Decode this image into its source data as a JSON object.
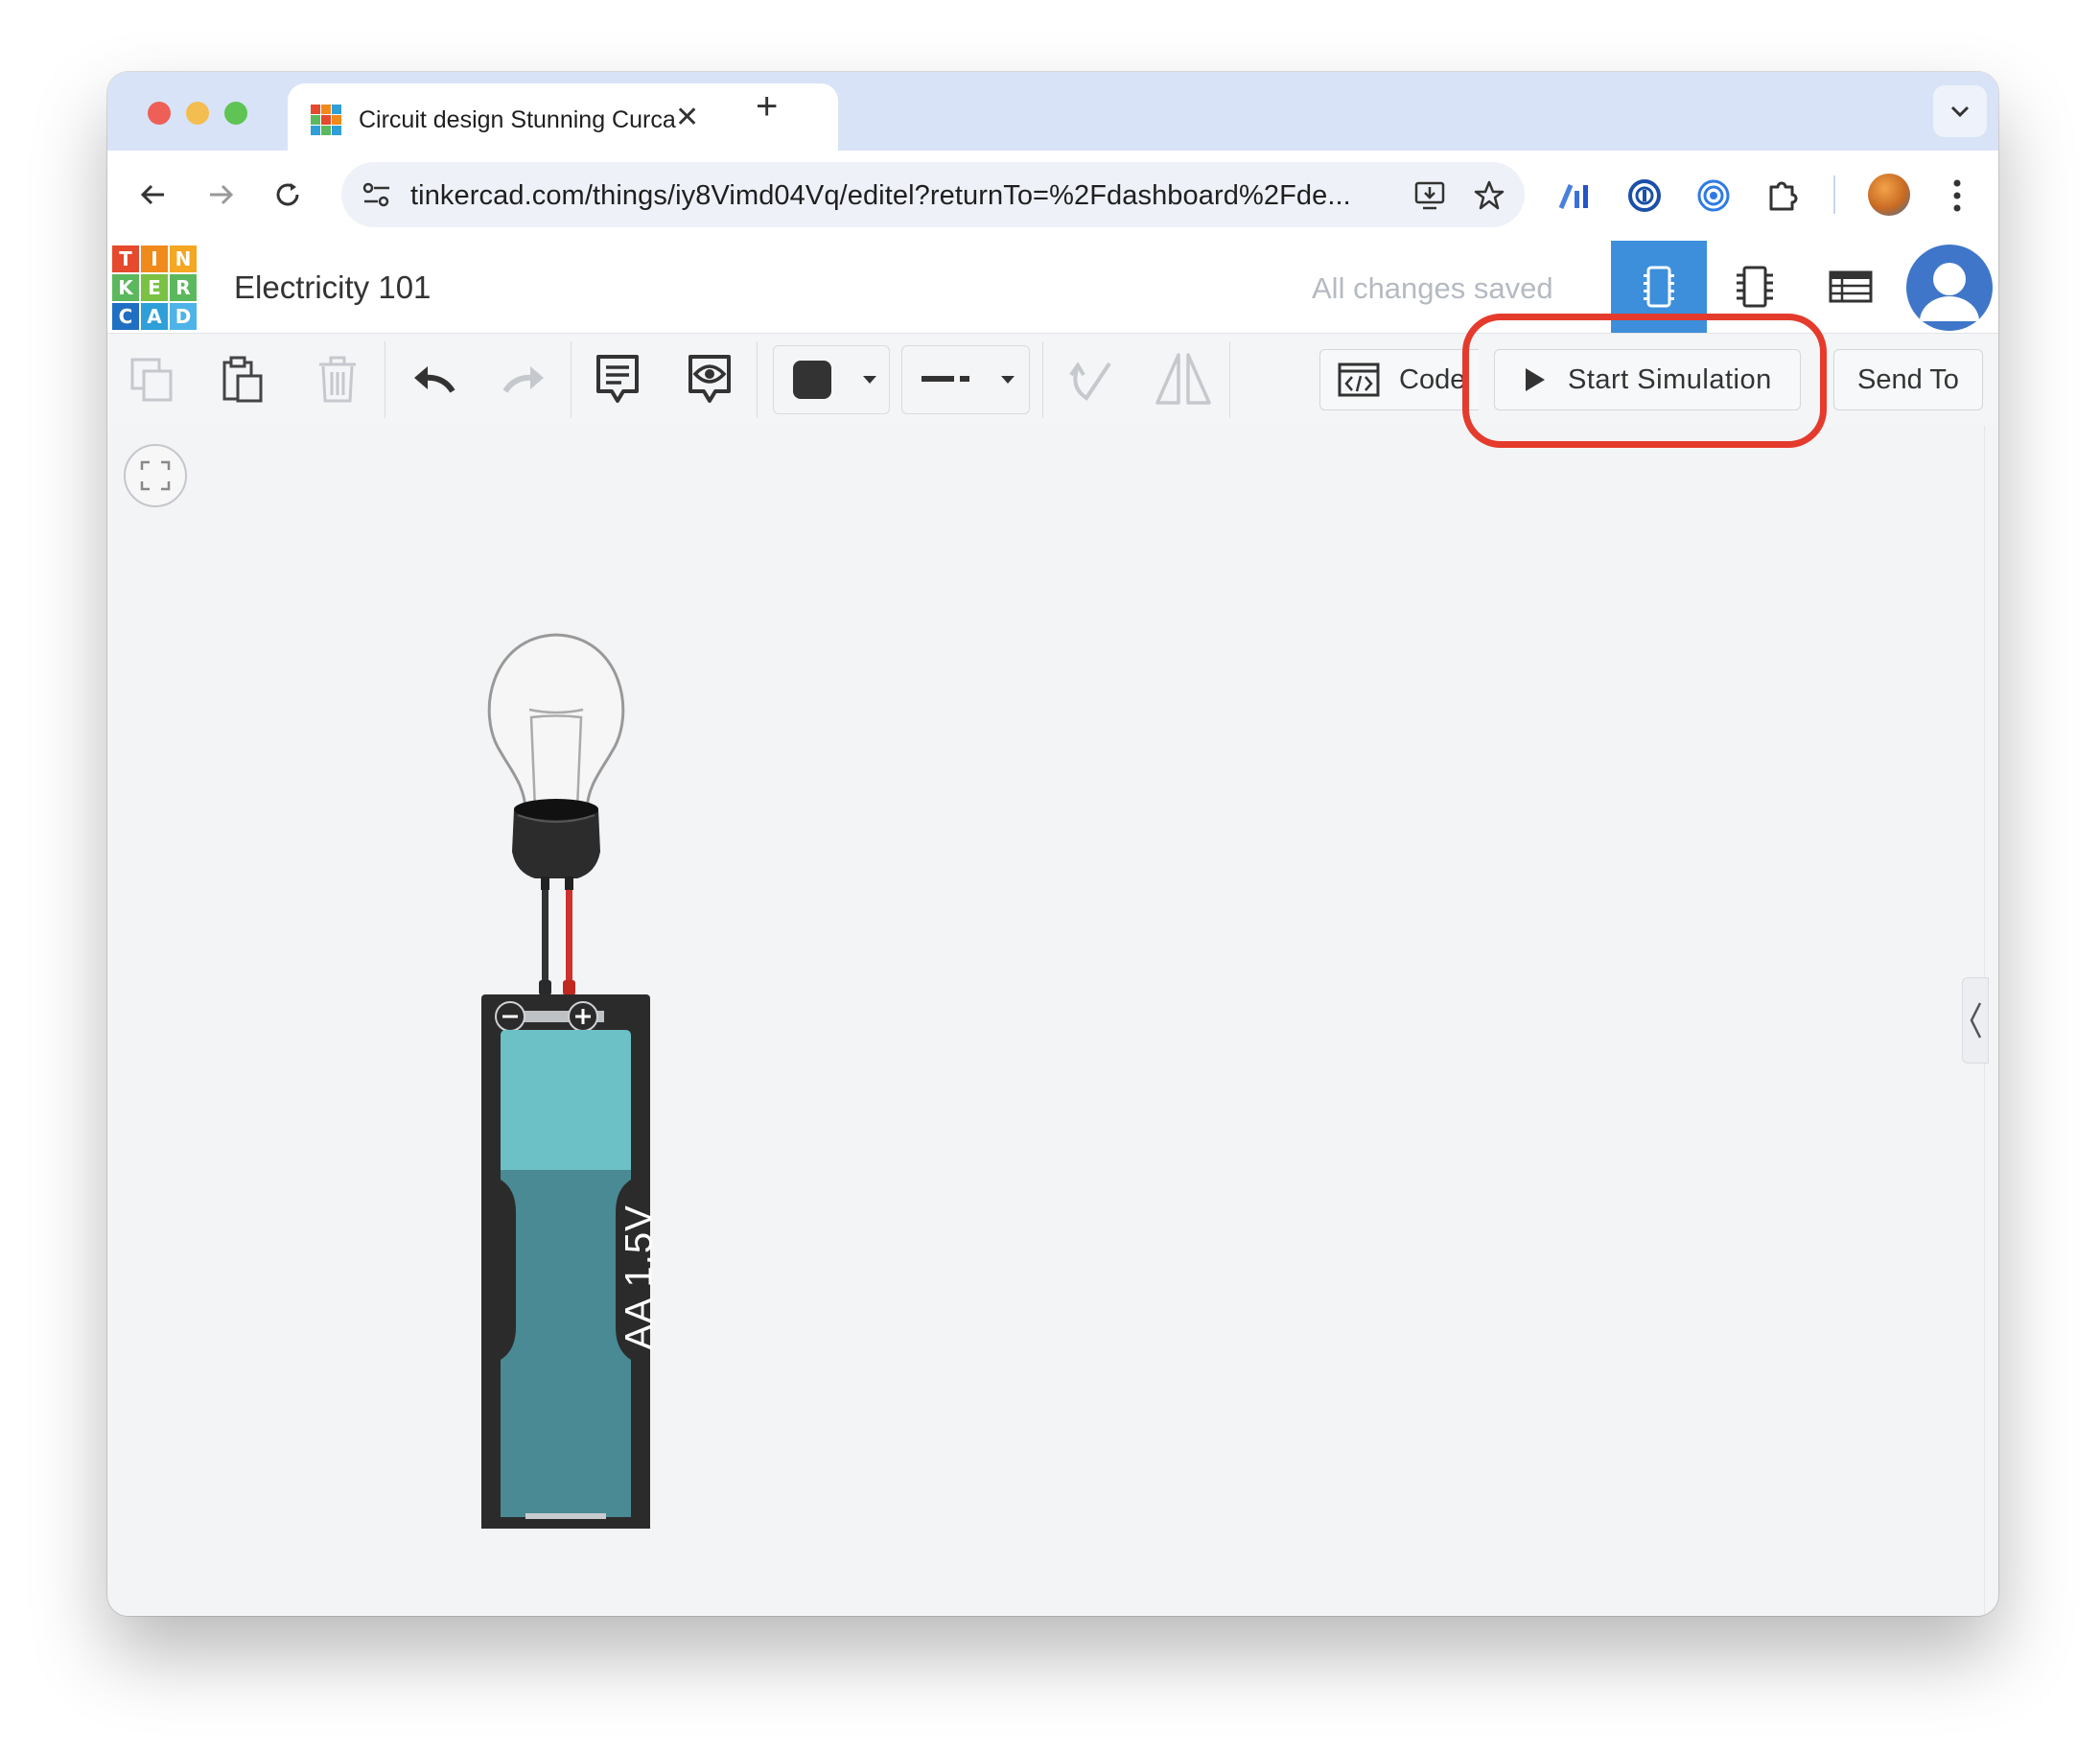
{
  "browser": {
    "tab_title": "Circuit design Stunning Curca",
    "close_glyph": "✕",
    "new_tab_glyph": "+",
    "url": "tinkercad.com/things/iy8Vimd04Vq/editel?returnTo=%2Fdashboard%2Fde..."
  },
  "app": {
    "logo_letters": [
      "T",
      "I",
      "N",
      "K",
      "E",
      "R",
      "C",
      "A",
      "D"
    ],
    "logo_colors": [
      "#e5492e",
      "#f08a1c",
      "#2e9fd8",
      "#5cb85c",
      "#e5492e",
      "#f08a1c",
      "#2e9fd8",
      "#5cb85c",
      "#2e9fd8"
    ],
    "project_name": "Electricity 101",
    "save_status": "All changes saved",
    "accent": "#3d8fdb"
  },
  "toolbar": {
    "code_label": "Code",
    "start_simulation_label": "Start Simulation",
    "send_to_label": "Send To",
    "fill_color": "#333333"
  },
  "circuit": {
    "battery_label": "AA 1.5V",
    "battery_color": "#4a8a94",
    "battery_top_color": "#6cc1c6",
    "wire_colors": [
      "#333333",
      "#d0312d"
    ]
  },
  "annotation": {
    "highlight_color": "#e53b2c"
  }
}
